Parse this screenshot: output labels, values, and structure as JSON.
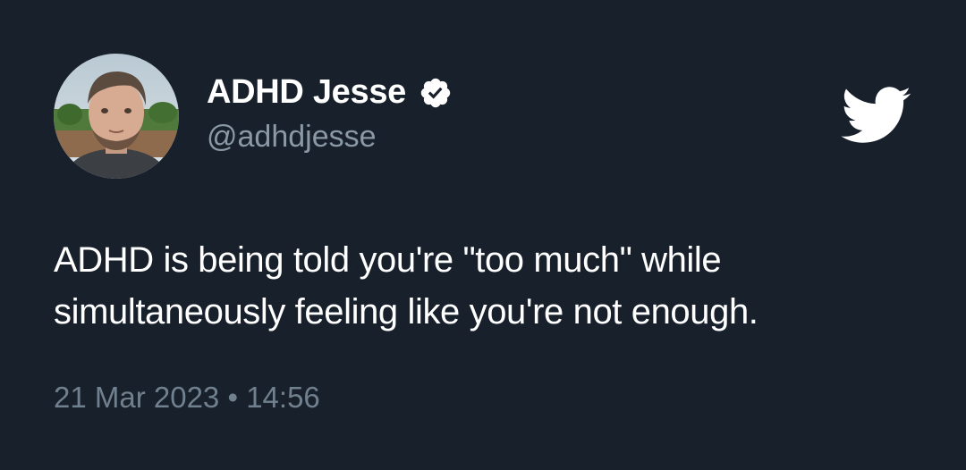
{
  "author": {
    "display_name": "ADHD Jesse",
    "handle": "@adhdjesse",
    "verified": true,
    "avatar_icon": "profile-photo"
  },
  "brand": {
    "logo_icon": "twitter-bird-icon"
  },
  "tweet": {
    "text_lines": [
      "ADHD is being told you're \"too much\" while",
      "simultaneously feeling like you're not enough."
    ],
    "date": "21 Mar 2023",
    "separator": "•",
    "time": "14:56"
  },
  "colors": {
    "background": "#17202b",
    "text_primary": "#ffffff",
    "text_secondary": "#8b98a5",
    "timestamp": "#71808e"
  }
}
